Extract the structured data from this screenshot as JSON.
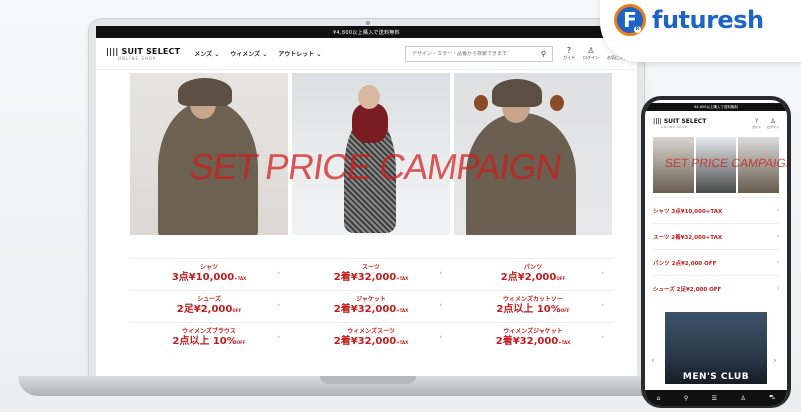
{
  "brand": {
    "name": "futuresh",
    "mark": "F",
    "registered": "R"
  },
  "site": {
    "announcement": "¥4,800以上購入で送料無料",
    "logo": "SUIT SELECT",
    "logo_sub": "ONLINE SHOP",
    "nav": [
      "メンズ ⌄",
      "ウィメンズ ⌄",
      "アウトレット ⌄"
    ],
    "search_placeholder": "デザイン・カラー・品番から検索できます",
    "header_icons": [
      {
        "label": "ガイド",
        "icon": "question-icon"
      },
      {
        "label": "ログイン",
        "icon": "user-icon"
      },
      {
        "label": "お気に入り",
        "icon": "heart-icon"
      }
    ],
    "campaign_title": "SET PRICE CAMPAIGN",
    "prices": [
      [
        {
          "category": "シャツ",
          "value": "3点¥10,000",
          "note": "+TAX"
        },
        {
          "category": "スーツ",
          "value": "2着¥32,000",
          "note": "+TAX"
        },
        {
          "category": "パンツ",
          "value": "2点¥2,000",
          "note": "OFF"
        }
      ],
      [
        {
          "category": "シューズ",
          "value": "2足¥2,000",
          "note": "OFF"
        },
        {
          "category": "ジャケット",
          "value": "2着¥32,000",
          "note": "+TAX"
        },
        {
          "category": "ウィメンズカットソー",
          "value": "2点以上 10%",
          "note": "OFF"
        }
      ],
      [
        {
          "category": "ウィメンズブラウス",
          "value": "2点以上 10%",
          "note": "OFF"
        },
        {
          "category": "ウィメンズスーツ",
          "value": "2着¥32,000",
          "note": "+TAX"
        },
        {
          "category": "ウィメンズジャケット",
          "value": "2着¥32,000",
          "note": "+TAX"
        }
      ]
    ]
  },
  "phone": {
    "announcement": "¥4,800以上購入で送料無料",
    "logo": "SUIT SELECT",
    "logo_sub": "ONLINE SHOP",
    "icons": [
      {
        "label": "ガイド"
      },
      {
        "label": "ログイン"
      }
    ],
    "campaign_title": "SET PRICE CAMPAIGN",
    "list": [
      "シャツ 3点¥10,000+TAX",
      "スーツ 2着¥32,000+TAX",
      "パンツ 2点¥2,000 OFF",
      "シューズ 2足¥2,000 OFF"
    ],
    "banner_text": "MEN'S CLUB"
  }
}
